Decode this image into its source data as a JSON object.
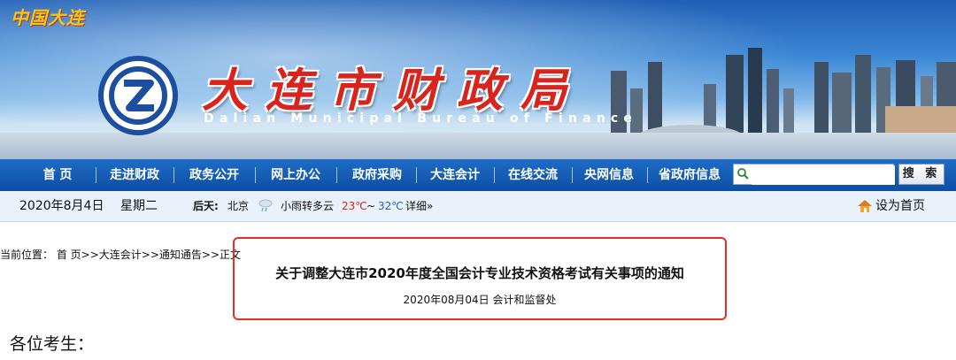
{
  "banner": {
    "china_dalian": "中国大连",
    "title_cn": "大连市财政局",
    "title_en": "Dalian Municipal Bureau of Finance"
  },
  "nav": {
    "items": [
      "首 页",
      "走进财政",
      "政务公开",
      "网上办公",
      "政府采购",
      "大连会计",
      "在线交流",
      "央网信息",
      "省政府信息"
    ],
    "search_placeholder": "",
    "search_button": "搜 索"
  },
  "info": {
    "date": "2020年8月4日",
    "weekday": "星期二",
    "weather_label": "后天:",
    "city": "北京",
    "weather_icon": "light-rain-icon",
    "weather_desc": "小雨转多云",
    "temp_low": "23℃",
    "tilde": "~",
    "temp_high": "32℃",
    "detail": "详细»",
    "set_home": "设为首页",
    "colors": {
      "temp_low": "#e02020",
      "temp_high": "#1f5fd0"
    }
  },
  "breadcrumb": {
    "prefix": "当前位置：",
    "home": "首 页",
    "sep1": ">>",
    "accounting": "大连会计",
    "sep2": ">>",
    "notices": "通知通告",
    "sep3": ">>",
    "current": "正文"
  },
  "article": {
    "title": "关于调整大连市2020年度全国会计专业技术资格考试有关事项的通知",
    "meta": "2020年08月04日  会计和监督处",
    "greeting": "各位考生："
  },
  "colors": {
    "nav_bg": "#0c4ea4",
    "info_bg": "#e9f1fb",
    "highlight": "#e0302a",
    "title_red": "#d8241d"
  }
}
